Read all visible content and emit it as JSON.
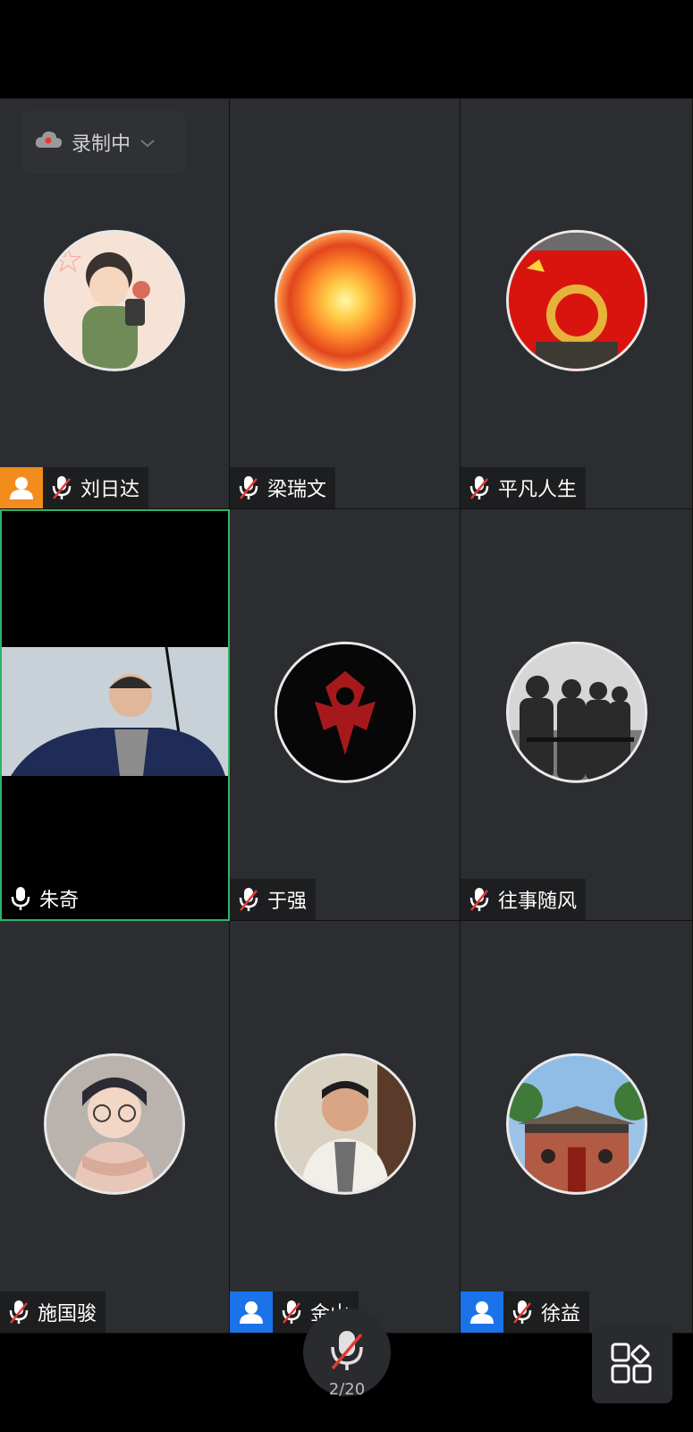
{
  "recording": {
    "label": "录制中"
  },
  "participants": [
    {
      "name": "刘日达",
      "host": "orange",
      "muted": true
    },
    {
      "name": "梁瑞文",
      "host": "",
      "muted": true
    },
    {
      "name": "平凡人生",
      "host": "",
      "muted": true
    },
    {
      "name": "朱奇",
      "host": "",
      "muted": false,
      "video": true
    },
    {
      "name": "于强",
      "host": "",
      "muted": true
    },
    {
      "name": "往事随风",
      "host": "",
      "muted": true
    },
    {
      "name": "施国骏",
      "host": "",
      "muted": true
    },
    {
      "name": "金山",
      "host": "blue",
      "muted": true
    },
    {
      "name": "徐益",
      "host": "blue",
      "muted": true
    }
  ],
  "footer": {
    "count": "2/20"
  },
  "colors": {
    "host_orange": "#f28c1c",
    "host_blue": "#1a73e8",
    "active_border": "#2fb36a",
    "muted_red": "#e53935"
  }
}
